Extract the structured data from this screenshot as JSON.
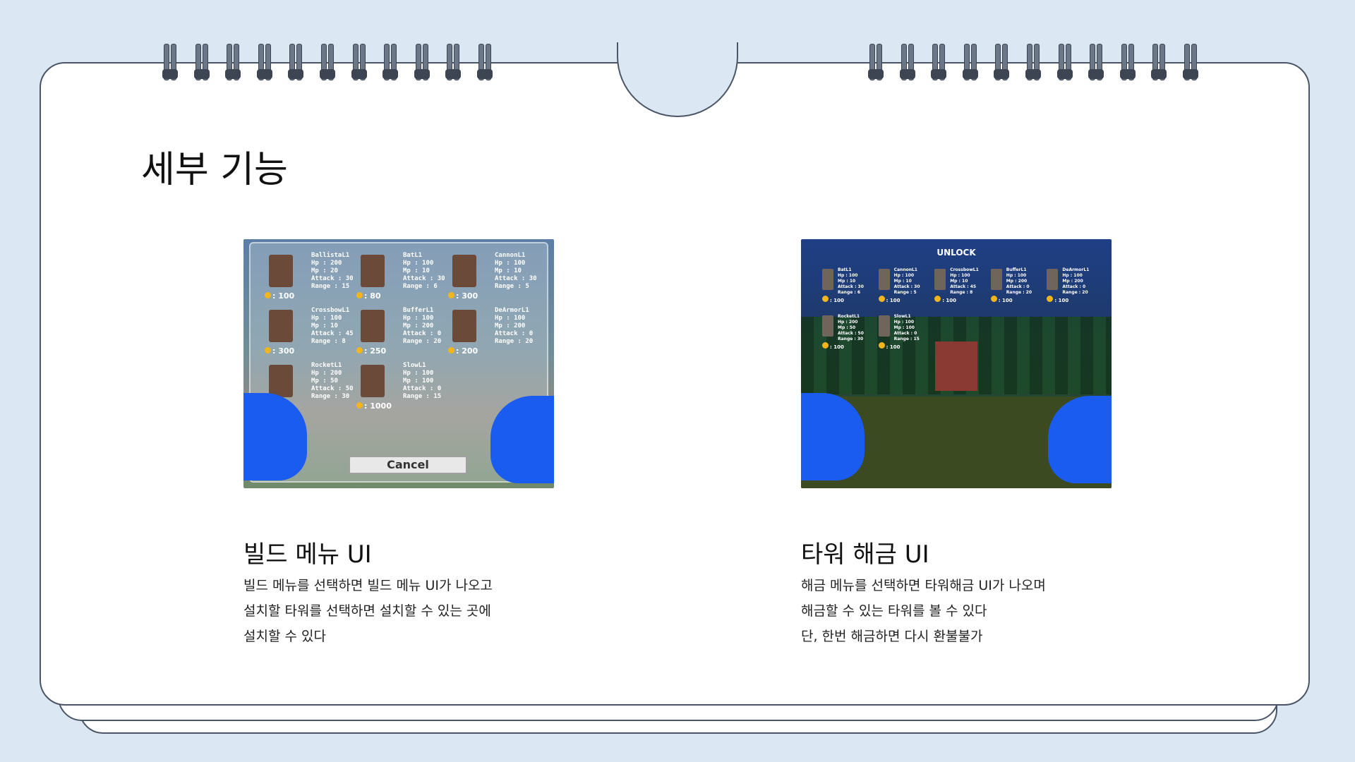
{
  "slide": {
    "title": "세부 기능"
  },
  "build_menu": {
    "image_alt": "빌드 메뉴 UI screenshot",
    "towers": [
      {
        "name": "BallistaL1",
        "hp": "Hp : 200",
        "mp": "Mp : 20",
        "attack": "Attack : 30",
        "range": "Range : 15",
        "cost": ": 100"
      },
      {
        "name": "BatL1",
        "hp": "Hp : 100",
        "mp": "Mp : 10",
        "attack": "Attack : 30",
        "range": "Range : 6",
        "cost": ": 80"
      },
      {
        "name": "CannonL1",
        "hp": "Hp : 100",
        "mp": "Mp : 10",
        "attack": "Attack : 30",
        "range": "Range : 5",
        "cost": ": 300"
      },
      {
        "name": "CrossbowL1",
        "hp": "Hp : 100",
        "mp": "Mp : 10",
        "attack": "Attack : 45",
        "range": "Range : 8",
        "cost": ": 300"
      },
      {
        "name": "BufferL1",
        "hp": "Hp : 100",
        "mp": "Mp : 200",
        "attack": "Attack : 0",
        "range": "Range : 20",
        "cost": ": 250"
      },
      {
        "name": "DeArmorL1",
        "hp": "Hp : 100",
        "mp": "Mp : 200",
        "attack": "Attack : 0",
        "range": "Range : 20",
        "cost": ": 200"
      },
      {
        "name": "RocketL1",
        "hp": "Hp : 200",
        "mp": "Mp : 50",
        "attack": "Attack : 50",
        "range": "Range : 30",
        "cost": ""
      },
      {
        "name": "SlowL1",
        "hp": "Hp : 100",
        "mp": "Mp : 100",
        "attack": "Attack : 0",
        "range": "Range : 15",
        "cost": ": 1000"
      }
    ],
    "cancel_label": "Cancel",
    "caption": "빌드 메뉴 UI",
    "description": [
      "빌드 메뉴를 선택하면 빌드 메뉴 UI가 나오고",
      "설치할 타워를 선택하면 설치할 수 있는 곳에",
      "설치할 수 있다"
    ]
  },
  "unlock_menu": {
    "header": "UNLOCK",
    "towers": [
      {
        "name": "BatL1",
        "hp": "Hp : 100",
        "mp": "Mp : 10",
        "attack": "Attack : 30",
        "range": "Range : 6",
        "cost": ": 100"
      },
      {
        "name": "CannonL1",
        "hp": "Hp : 100",
        "mp": "Mp : 10",
        "attack": "Attack : 30",
        "range": "Range : 5",
        "cost": ": 100"
      },
      {
        "name": "CrossbowL1",
        "hp": "Hp : 100",
        "mp": "Mp : 10",
        "attack": "Attack : 45",
        "range": "Range : 8",
        "cost": ": 100"
      },
      {
        "name": "BufferL1",
        "hp": "Hp : 100",
        "mp": "Mp : 200",
        "attack": "Attack : 0",
        "range": "Range : 20",
        "cost": ": 100"
      },
      {
        "name": "DeArmorL1",
        "hp": "Hp : 100",
        "mp": "Mp : 200",
        "attack": "Attack : 0",
        "range": "Range : 20",
        "cost": ": 100"
      },
      {
        "name": "RocketL1",
        "hp": "Hp : 200",
        "mp": "Mp : 50",
        "attack": "Attack : 50",
        "range": "Range : 30",
        "cost": ": 100"
      },
      {
        "name": "SlowL1",
        "hp": "Hp : 100",
        "mp": "Mp : 100",
        "attack": "Attack : 0",
        "range": "Range : 15",
        "cost": ": 100"
      }
    ],
    "caption": "타워 해금 UI",
    "description": [
      "해금 메뉴를 선택하면 타워해금 UI가 나오며",
      "해금할 수 있는 타워를 볼 수 있다",
      "단, 한번 해금하면 다시 환불불가"
    ]
  }
}
